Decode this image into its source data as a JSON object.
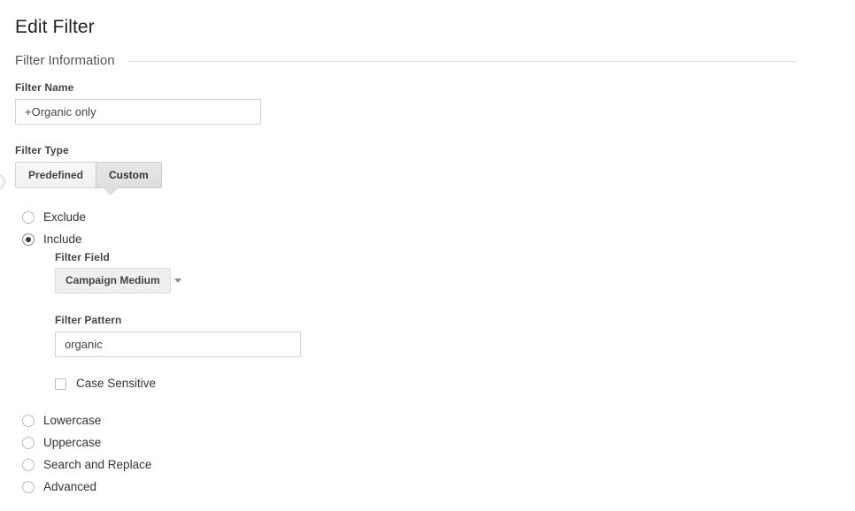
{
  "page": {
    "title": "Edit Filter"
  },
  "section": {
    "title": "Filter Information"
  },
  "filter_name": {
    "label": "Filter Name",
    "value": "+Organic only",
    "placeholder": "Filter Name"
  },
  "filter_type": {
    "label": "Filter Type",
    "tabs": [
      {
        "label": "Predefined",
        "selected": false
      },
      {
        "label": "Custom",
        "selected": true
      }
    ]
  },
  "custom_options": {
    "top": [
      {
        "label": "Exclude",
        "selected": false
      },
      {
        "label": "Include",
        "selected": true
      }
    ],
    "bottom": [
      {
        "label": "Lowercase",
        "selected": false
      },
      {
        "label": "Uppercase",
        "selected": false
      },
      {
        "label": "Search and Replace",
        "selected": false
      },
      {
        "label": "Advanced",
        "selected": false
      }
    ]
  },
  "filter_field": {
    "label": "Filter Field",
    "value": "Campaign Medium",
    "caret_icon": "chevron-down-icon"
  },
  "filter_pattern": {
    "label": "Filter Pattern",
    "value": "organic",
    "placeholder": "Filter Pattern"
  },
  "case_sensitive": {
    "label": "Case Sensitive",
    "checked": false
  },
  "colors": {
    "text": "#333333",
    "label": "#444444",
    "rule": "#e0e0e0",
    "tab_selected_bg": "#dedede",
    "dropdown_bg": "#efefef"
  }
}
